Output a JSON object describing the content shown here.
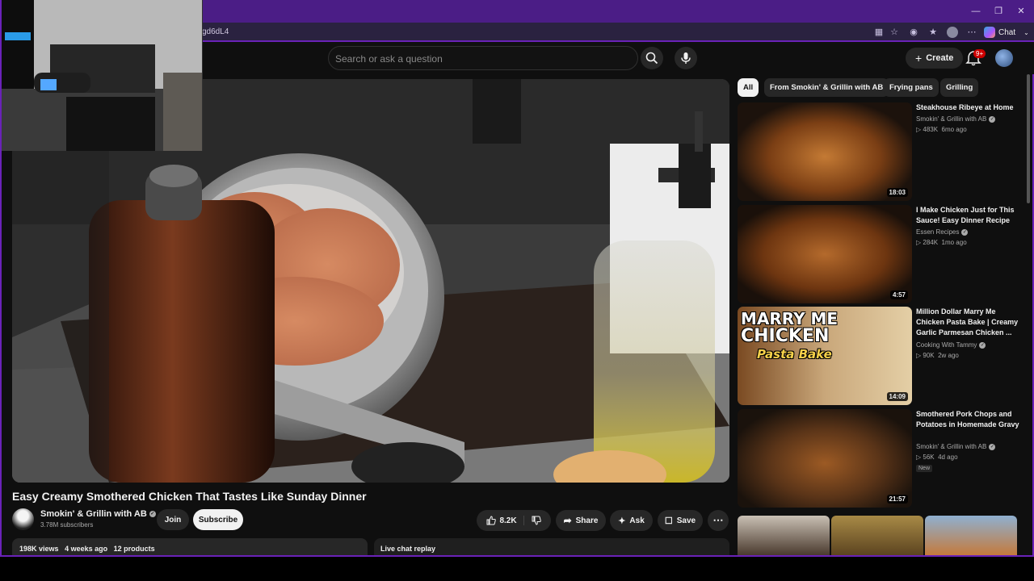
{
  "browser": {
    "url_fragment": "gd6dL4",
    "chat_label": "Chat"
  },
  "header": {
    "search_placeholder": "Search or ask a question",
    "create_label": "Create",
    "notification_count": "9+"
  },
  "video": {
    "title": "Easy Creamy Smothered Chicken That Tastes Like Sunday Dinner",
    "channel": "Smokin' & Grillin with AB",
    "subscribers": "3.78M subscribers",
    "join_label": "Join",
    "subscribe_label": "Subscribe",
    "likes": "8.2K",
    "share_label": "Share",
    "ask_label": "Ask",
    "save_label": "Save",
    "views": "198K views",
    "age": "4 weeks ago",
    "products": "12 products",
    "live_chat_label": "Live chat replay"
  },
  "filters": [
    {
      "label": "All",
      "active": true
    },
    {
      "label": "From Smokin' & Grillin with AB",
      "active": false
    },
    {
      "label": "Frying pans",
      "active": false
    },
    {
      "label": "Grilling",
      "active": false
    }
  ],
  "recommendations": [
    {
      "title": "Steakhouse Ribeye at Home",
      "channel": "Smokin' & Grillin with AB",
      "views": "483K",
      "age": "6mo ago",
      "duration": "18:03"
    },
    {
      "title": "I Make Chicken Just for This Sauce! Easy Dinner Recipe",
      "channel": "Essen Recipes",
      "views": "284K",
      "age": "1mo ago",
      "duration": "4:57"
    },
    {
      "title": "Million Dollar Marry Me Chicken Pasta Bake | Creamy Garlic Parmesan Chicken ...",
      "channel": "Cooking With Tammy",
      "views": "90K",
      "age": "2w ago",
      "duration": "14:09",
      "thumb_text_1": "MARRY ME",
      "thumb_text_2": "CHICKEN",
      "thumb_text_3": "Pasta Bake"
    },
    {
      "title": "Smothered Pork Chops and Potatoes in Homemade Gravy",
      "channel": "Smokin' & Grillin with AB",
      "views": "56K",
      "age": "4d ago",
      "duration": "21:57",
      "badge": "New"
    }
  ]
}
